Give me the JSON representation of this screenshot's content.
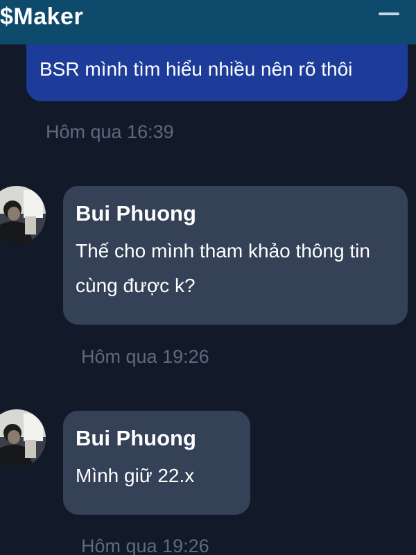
{
  "app": {
    "title": "$Maker",
    "minimize_icon": "minimize-icon"
  },
  "messages": [
    {
      "direction": "outgoing",
      "text": "BSR mình tìm hiểu nhiều nên rõ thôi",
      "time": "Hôm qua 16:39"
    },
    {
      "direction": "incoming",
      "sender": "Bui Phuong",
      "text": "Thế cho mình tham khảo thông tin cùng được k?",
      "time": "Hôm qua 19:26",
      "avatar_icon": "user-avatar"
    },
    {
      "direction": "incoming",
      "sender": "Bui Phuong",
      "text": "Mình giữ 22.x",
      "time": "Hôm qua 19:26",
      "avatar_icon": "user-avatar"
    }
  ],
  "colors": {
    "titlebar": "#0e4a6c",
    "background": "#121a29",
    "outgoing_bubble": "#1d3b99",
    "incoming_bubble": "#344156",
    "timestamp": "#5e6a7d"
  }
}
